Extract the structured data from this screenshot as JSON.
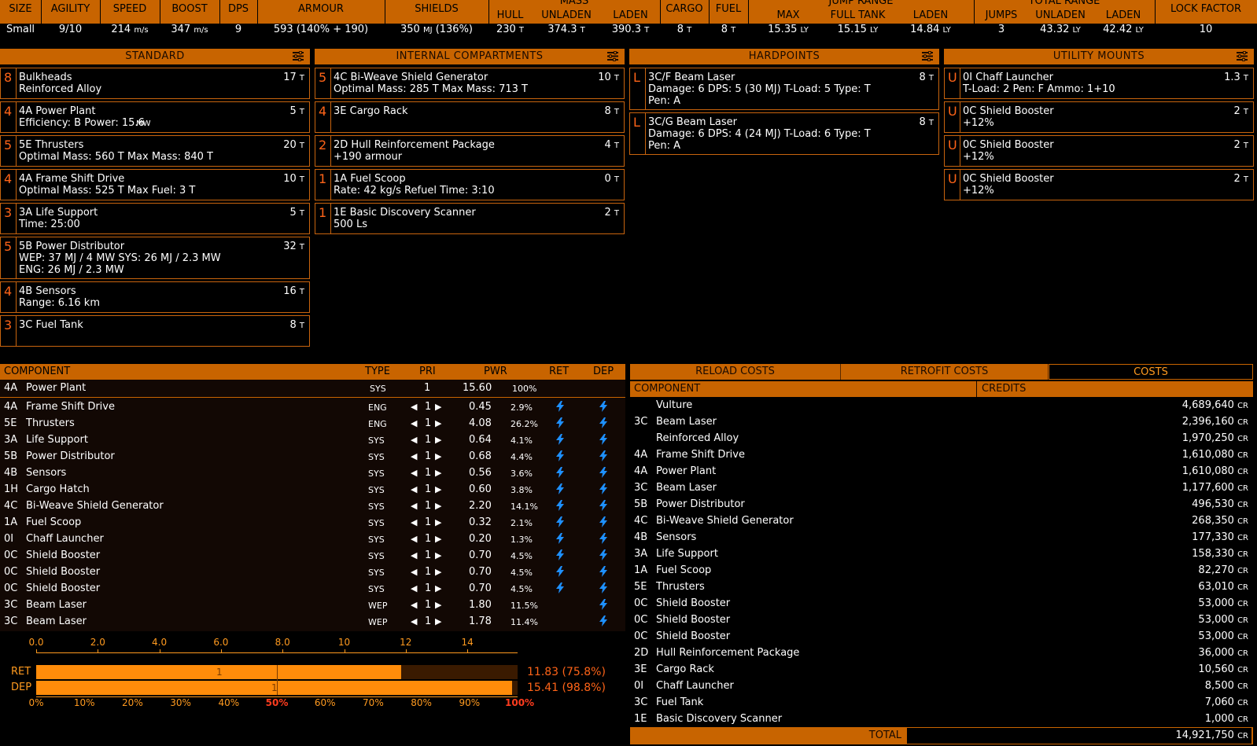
{
  "stats": {
    "headers": {
      "size": "SIZE",
      "agility": "AGILITY",
      "speed": "SPEED",
      "boost": "BOOST",
      "dps": "DPS",
      "armour": "ARMOUR",
      "shields": "SHIELDS",
      "mass": "MASS",
      "hull": "HULL",
      "unladen": "UNLADEN",
      "laden": "LADEN",
      "cargo": "CARGO",
      "fuel": "FUEL",
      "jump_range": "JUMP RANGE",
      "max": "MAX",
      "full_tank": "FULL TANK",
      "jr_laden": "LADEN",
      "total_range": "TOTAL RANGE",
      "jumps": "JUMPS",
      "tr_unladen": "UNLADEN",
      "tr_laden": "LADEN",
      "lock_factor": "LOCK FACTOR"
    },
    "values": {
      "size": "Small",
      "agility": "9/10",
      "speed": "214",
      "speed_u": "m/s",
      "boost": "347",
      "boost_u": "m/s",
      "dps": "9",
      "armour": "593 (140% + 190)",
      "shields": "350",
      "shields_u": "MJ",
      "shields_pct": "(136%)",
      "hull": "230",
      "unladen": "374.3",
      "laden": "390.3",
      "cargo": "8",
      "fuel": "8",
      "t": "T",
      "ly": "LY",
      "max": "15.35",
      "full_tank": "15.15",
      "jr_laden": "14.84",
      "jumps": "3",
      "tr_unladen": "43.32",
      "tr_laden": "42.42",
      "lock_factor": "10"
    }
  },
  "panels": {
    "standard": "STANDARD",
    "internal": "INTERNAL COMPARTMENTS",
    "hardpoints": "HARDPOINTS",
    "utility": "UTILITY MOUNTS"
  },
  "standard": [
    {
      "cls": "8",
      "name": "Bulkheads",
      "l2": "Reinforced Alloy",
      "wt": "17"
    },
    {
      "cls": "4",
      "name": "4A Power Plant",
      "l2": "Efficiency: B   Power: 15.6",
      "l2u": "MW",
      "wt": "5"
    },
    {
      "cls": "5",
      "name": "5E Thrusters",
      "l2": "Optimal Mass: 560 T   Max Mass: 840 T",
      "wt": "20"
    },
    {
      "cls": "4",
      "name": "4A Frame Shift Drive",
      "l2": "Optimal Mass: 525 T   Max Fuel: 3 T",
      "wt": "10"
    },
    {
      "cls": "3",
      "name": "3A Life Support",
      "l2": "Time: 25:00",
      "wt": "5"
    },
    {
      "cls": "5",
      "name": "5B Power Distributor",
      "l2": "WEP: 37 MJ / 4 MW   SYS: 26 MJ / 2.3 MW",
      "l3": "ENG: 26 MJ / 2.3 MW",
      "wt": "32"
    },
    {
      "cls": "4",
      "name": "4B Sensors",
      "l2": "Range: 6.16 km",
      "wt": "16"
    },
    {
      "cls": "3",
      "name": "3C Fuel Tank",
      "l2": "",
      "wt": "8"
    }
  ],
  "internal": [
    {
      "cls": "5",
      "name": "4C Bi-Weave Shield Generator",
      "l2": "Optimal Mass: 285 T   Max Mass: 713 T",
      "wt": "10"
    },
    {
      "cls": "4",
      "name": "3E Cargo Rack",
      "l2": "",
      "wt": "8"
    },
    {
      "cls": "2",
      "name": "2D Hull Reinforcement Package",
      "l2": "+190 armour",
      "wt": "4"
    },
    {
      "cls": "1",
      "name": "1A Fuel Scoop",
      "l2": "Rate: 42 kg/s   Refuel Time: 3:10",
      "wt": "0"
    },
    {
      "cls": "1",
      "name": "1E Basic Discovery Scanner",
      "l2": "500 Ls",
      "wt": "2"
    }
  ],
  "hardpoints": [
    {
      "cls": "L",
      "name": "3C/F Beam Laser",
      "l2": "Damage: 6   DPS: 5 (30 MJ)   T-Load: 5   Type: T",
      "l3": "Pen: A",
      "wt": "8"
    },
    {
      "cls": "L",
      "name": "3C/G Beam Laser",
      "l2": "Damage: 6   DPS: 4 (24 MJ)   T-Load: 6   Type: T",
      "l3": "Pen: A",
      "wt": "8"
    }
  ],
  "utility": [
    {
      "cls": "U",
      "name": "0I Chaff Launcher",
      "l2": "T-Load: 2   Pen: F   Ammo: 1+10",
      "wt": "1.3"
    },
    {
      "cls": "U",
      "name": "0C Shield Booster",
      "l2": "+12%",
      "wt": "2"
    },
    {
      "cls": "U",
      "name": "0C Shield Booster",
      "l2": "+12%",
      "wt": "2"
    },
    {
      "cls": "U",
      "name": "0C Shield Booster",
      "l2": "+12%",
      "wt": "2"
    }
  ],
  "power": {
    "headers": {
      "component": "COMPONENT",
      "type": "TYPE",
      "pri": "PRI",
      "pwr": "PWR",
      "ret": "RET",
      "dep": "DEP"
    },
    "plant": {
      "cls": "4A",
      "name": "Power Plant",
      "type": "SYS",
      "pri": "1",
      "pwr": "15.60",
      "pct": "100%"
    },
    "rows": [
      {
        "cls": "4A",
        "name": "Frame Shift Drive",
        "type": "ENG",
        "pri": "1",
        "pwr": "0.45",
        "pct": "2.9%",
        "ret": true,
        "dep": true
      },
      {
        "cls": "5E",
        "name": "Thrusters",
        "type": "ENG",
        "pri": "1",
        "pwr": "4.08",
        "pct": "26.2%",
        "ret": true,
        "dep": true
      },
      {
        "cls": "3A",
        "name": "Life Support",
        "type": "SYS",
        "pri": "1",
        "pwr": "0.64",
        "pct": "4.1%",
        "ret": true,
        "dep": true
      },
      {
        "cls": "5B",
        "name": "Power Distributor",
        "type": "SYS",
        "pri": "1",
        "pwr": "0.68",
        "pct": "4.4%",
        "ret": true,
        "dep": true
      },
      {
        "cls": "4B",
        "name": "Sensors",
        "type": "SYS",
        "pri": "1",
        "pwr": "0.56",
        "pct": "3.6%",
        "ret": true,
        "dep": true
      },
      {
        "cls": "1H",
        "name": "Cargo Hatch",
        "type": "SYS",
        "pri": "1",
        "pwr": "0.60",
        "pct": "3.8%",
        "ret": true,
        "dep": true
      },
      {
        "cls": "4C",
        "name": "Bi-Weave Shield Generator",
        "type": "SYS",
        "pri": "1",
        "pwr": "2.20",
        "pct": "14.1%",
        "ret": true,
        "dep": true
      },
      {
        "cls": "1A",
        "name": "Fuel Scoop",
        "type": "SYS",
        "pri": "1",
        "pwr": "0.32",
        "pct": "2.1%",
        "ret": true,
        "dep": true
      },
      {
        "cls": "0I",
        "name": "Chaff Launcher",
        "type": "SYS",
        "pri": "1",
        "pwr": "0.20",
        "pct": "1.3%",
        "ret": true,
        "dep": true
      },
      {
        "cls": "0C",
        "name": "Shield Booster",
        "type": "SYS",
        "pri": "1",
        "pwr": "0.70",
        "pct": "4.5%",
        "ret": true,
        "dep": true
      },
      {
        "cls": "0C",
        "name": "Shield Booster",
        "type": "SYS",
        "pri": "1",
        "pwr": "0.70",
        "pct": "4.5%",
        "ret": true,
        "dep": true
      },
      {
        "cls": "0C",
        "name": "Shield Booster",
        "type": "SYS",
        "pri": "1",
        "pwr": "0.70",
        "pct": "4.5%",
        "ret": true,
        "dep": true
      },
      {
        "cls": "3C",
        "name": "Beam Laser",
        "type": "WEP",
        "pri": "1",
        "pwr": "1.80",
        "pct": "11.5%",
        "ret": false,
        "dep": true
      },
      {
        "cls": "3C",
        "name": "Beam Laser",
        "type": "WEP",
        "pri": "1",
        "pwr": "1.78",
        "pct": "11.4%",
        "ret": false,
        "dep": true
      }
    ]
  },
  "bars": {
    "axis_top": [
      "0.0",
      "2.0",
      "4.0",
      "6.0",
      "8.0",
      "10",
      "12",
      "14"
    ],
    "axis_bottom": [
      "0%",
      "10%",
      "20%",
      "30%",
      "40%",
      "50%",
      "60%",
      "70%",
      "80%",
      "90%",
      "100%"
    ],
    "ret": {
      "label": "RET",
      "fraction": 0.758,
      "marker": "1",
      "text": "11.83 (75.8%)"
    },
    "dep": {
      "label": "DEP",
      "fraction": 0.988,
      "marker": "1",
      "text": "15.41 (98.8%)"
    }
  },
  "costs": {
    "tabs": [
      "RELOAD COSTS",
      "RETROFIT COSTS",
      "COSTS"
    ],
    "headers": {
      "component": "COMPONENT",
      "credits": "CREDITS"
    },
    "unit": "CR",
    "rows": [
      {
        "cls": "",
        "name": "Vulture",
        "credits": "4,689,640"
      },
      {
        "cls": "3C",
        "name": "Beam Laser",
        "credits": "2,396,160"
      },
      {
        "cls": "",
        "name": "Reinforced Alloy",
        "credits": "1,970,250"
      },
      {
        "cls": "4A",
        "name": "Frame Shift Drive",
        "credits": "1,610,080"
      },
      {
        "cls": "4A",
        "name": "Power Plant",
        "credits": "1,610,080"
      },
      {
        "cls": "3C",
        "name": "Beam Laser",
        "credits": "1,177,600"
      },
      {
        "cls": "5B",
        "name": "Power Distributor",
        "credits": "496,530"
      },
      {
        "cls": "4C",
        "name": "Bi-Weave Shield Generator",
        "credits": "268,350"
      },
      {
        "cls": "4B",
        "name": "Sensors",
        "credits": "177,330"
      },
      {
        "cls": "3A",
        "name": "Life Support",
        "credits": "158,330"
      },
      {
        "cls": "1A",
        "name": "Fuel Scoop",
        "credits": "82,270"
      },
      {
        "cls": "5E",
        "name": "Thrusters",
        "credits": "63,010"
      },
      {
        "cls": "0C",
        "name": "Shield Booster",
        "credits": "53,000"
      },
      {
        "cls": "0C",
        "name": "Shield Booster",
        "credits": "53,000"
      },
      {
        "cls": "0C",
        "name": "Shield Booster",
        "credits": "53,000"
      },
      {
        "cls": "2D",
        "name": "Hull Reinforcement Package",
        "credits": "36,000"
      },
      {
        "cls": "3E",
        "name": "Cargo Rack",
        "credits": "10,560"
      },
      {
        "cls": "0I",
        "name": "Chaff Launcher",
        "credits": "8,500"
      },
      {
        "cls": "3C",
        "name": "Fuel Tank",
        "credits": "7,060"
      },
      {
        "cls": "1E",
        "name": "Basic Discovery Scanner",
        "credits": "1,000"
      }
    ],
    "total_label": "TOTAL",
    "total": "14,921,750"
  },
  "colors": {
    "accent": "#c86400",
    "bar": "#ff8c0a",
    "text": "#ffffff",
    "orange": "#ff9a1f",
    "red": "#ff3c1e",
    "bolt": "#1e90ff"
  }
}
